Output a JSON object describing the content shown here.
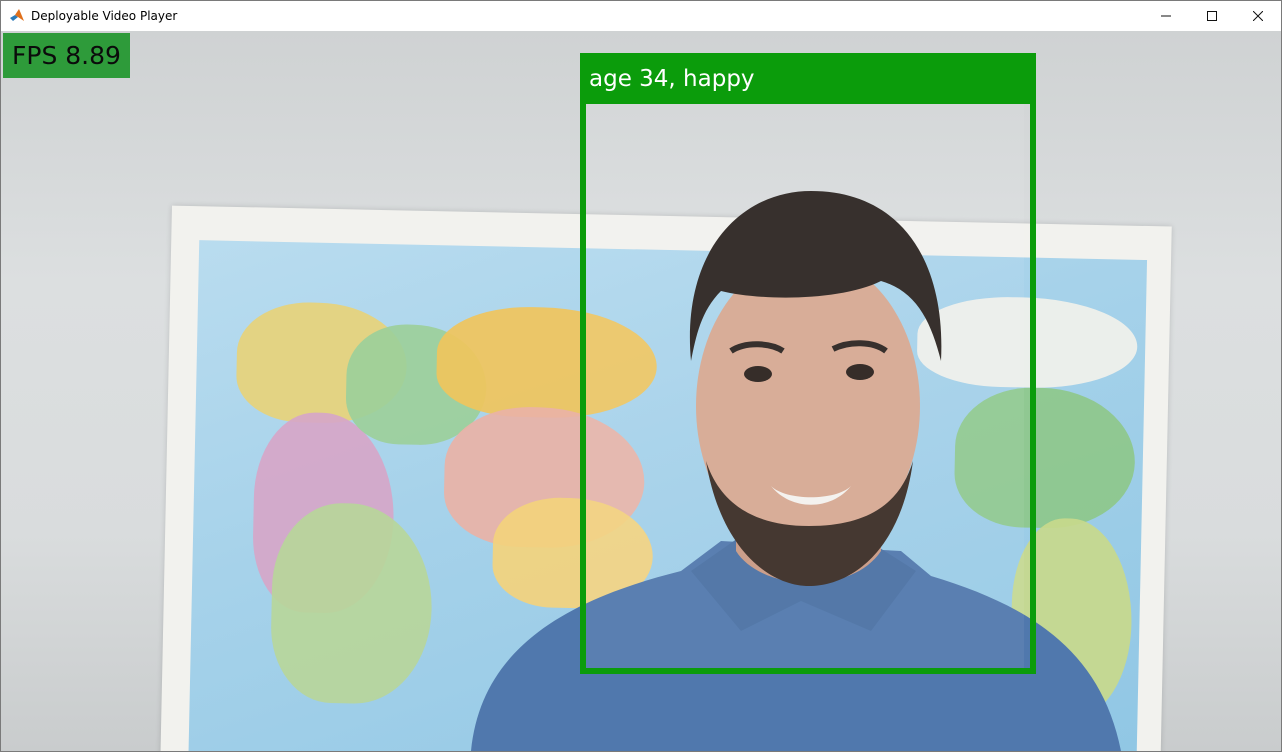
{
  "window": {
    "title": "Deployable Video Player",
    "app_icon": "matlab-icon",
    "controls": [
      "minimize-icon",
      "maximize-icon",
      "close-icon"
    ]
  },
  "overlay": {
    "fps_text": "FPS 8.89",
    "fps_bg_color": "#2e9b3a",
    "face_label": "age 34, happy",
    "box_color": "#0b9c0b"
  }
}
